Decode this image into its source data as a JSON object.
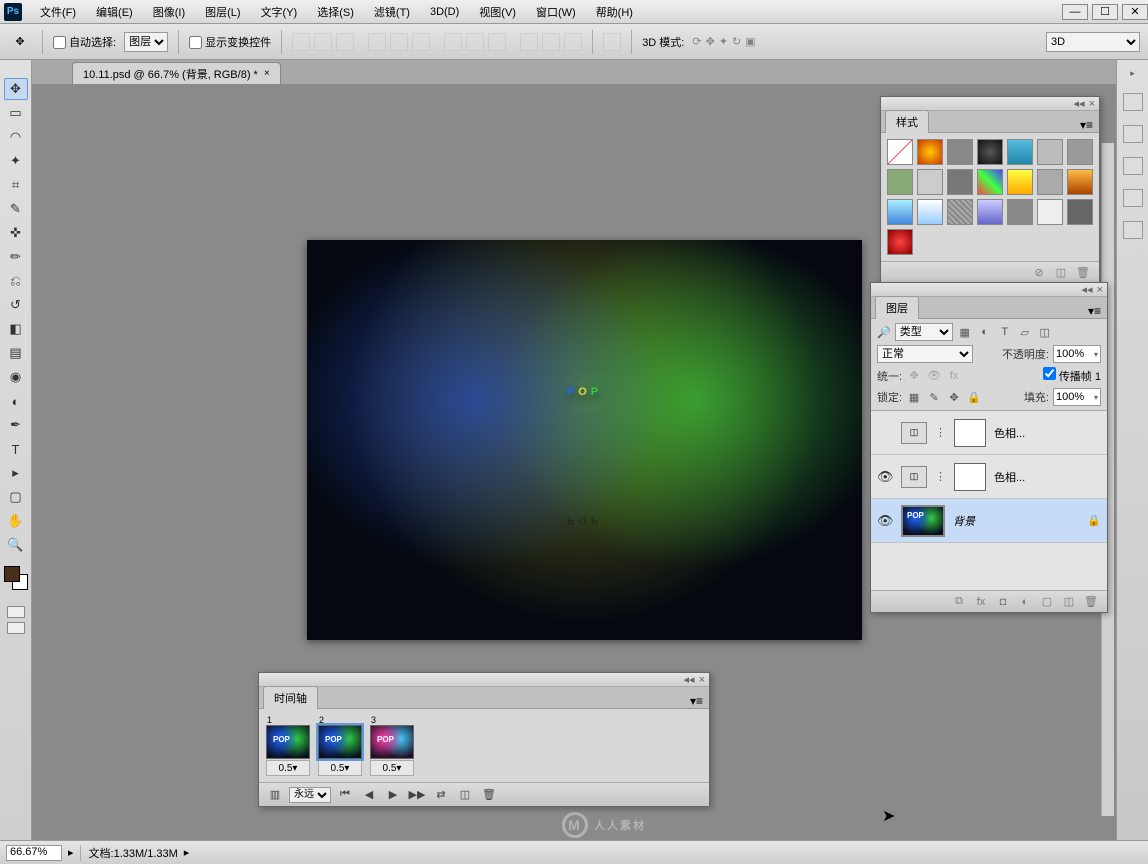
{
  "menu": {
    "items": [
      "文件(F)",
      "编辑(E)",
      "图像(I)",
      "图层(L)",
      "文字(Y)",
      "选择(S)",
      "滤镜(T)",
      "3D(D)",
      "视图(V)",
      "窗口(W)",
      "帮助(H)"
    ]
  },
  "window_controls": {
    "min": "—",
    "max": "☐",
    "close": "✕"
  },
  "options": {
    "auto_select": "自动选择:",
    "auto_select_mode": "图层",
    "show_transform": "显示变换控件",
    "mode3d_label": "3D 模式:",
    "mode3d_value": "3D"
  },
  "document_tab": {
    "title": "10.11.psd @ 66.7% (背景, RGB/8) *"
  },
  "styles_panel": {
    "title": "样式"
  },
  "layers_panel": {
    "title": "图层",
    "filter_kind": "类型",
    "blend_mode": "正常",
    "opacity_label": "不透明度:",
    "opacity_value": "100%",
    "unify_label": "统一:",
    "propagate_label": "传播帧 1",
    "lock_label": "锁定:",
    "fill_label": "填充:",
    "fill_value": "100%",
    "layers": [
      {
        "name": "色相..."
      },
      {
        "name": "色相..."
      },
      {
        "name": "背景"
      }
    ]
  },
  "timeline_panel": {
    "title": "时间轴",
    "frames": [
      {
        "num": "1",
        "delay": "0.5▾"
      },
      {
        "num": "2",
        "delay": "0.5▾"
      },
      {
        "num": "3",
        "delay": "0.5▾"
      }
    ],
    "loop": "永远"
  },
  "status": {
    "zoom": "66.67%",
    "doc_info": "文档:1.33M/1.33M"
  },
  "canvas_text": "POP",
  "watermark": "人人素材"
}
